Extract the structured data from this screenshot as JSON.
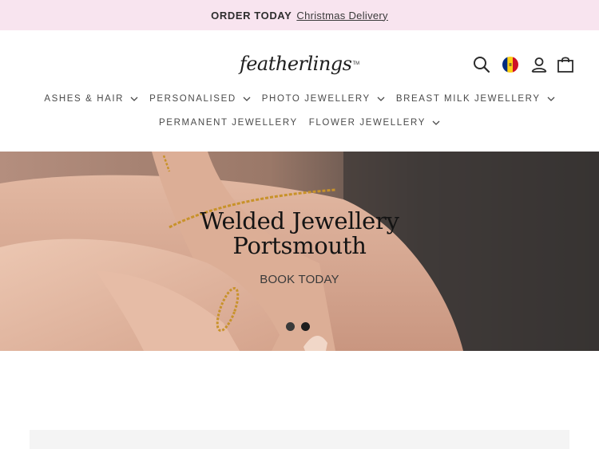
{
  "announcement": {
    "lead": "ORDER TODAY",
    "link": "Christmas Delivery"
  },
  "brand": {
    "logo_text": "featherlings",
    "tm": "TM"
  },
  "utility": {
    "icons": [
      "search-icon",
      "flag-icon",
      "account-icon",
      "cart-icon"
    ],
    "flag_colors": [
      "#002b7f",
      "#fcd116",
      "#ce1126"
    ]
  },
  "nav": {
    "row1": [
      {
        "label": "ASHES & HAIR",
        "dropdown": true
      },
      {
        "label": "PERSONALISED",
        "dropdown": true
      },
      {
        "label": "PHOTO JEWELLERY",
        "dropdown": true
      },
      {
        "label": "BREAST MILK JEWELLERY",
        "dropdown": true
      }
    ],
    "row2": [
      {
        "label": "PERMANENT JEWELLERY",
        "dropdown": false
      },
      {
        "label": "FLOWER JEWELLERY",
        "dropdown": true
      }
    ]
  },
  "hero": {
    "title_line1": "Welded Jewellery",
    "title_line2": "Portsmouth",
    "cta": "BOOK TODAY",
    "slide_count": 2,
    "active_slide": 2
  },
  "colors": {
    "announce_bg": "#f8e4ef",
    "text": "#2b2b2b"
  }
}
